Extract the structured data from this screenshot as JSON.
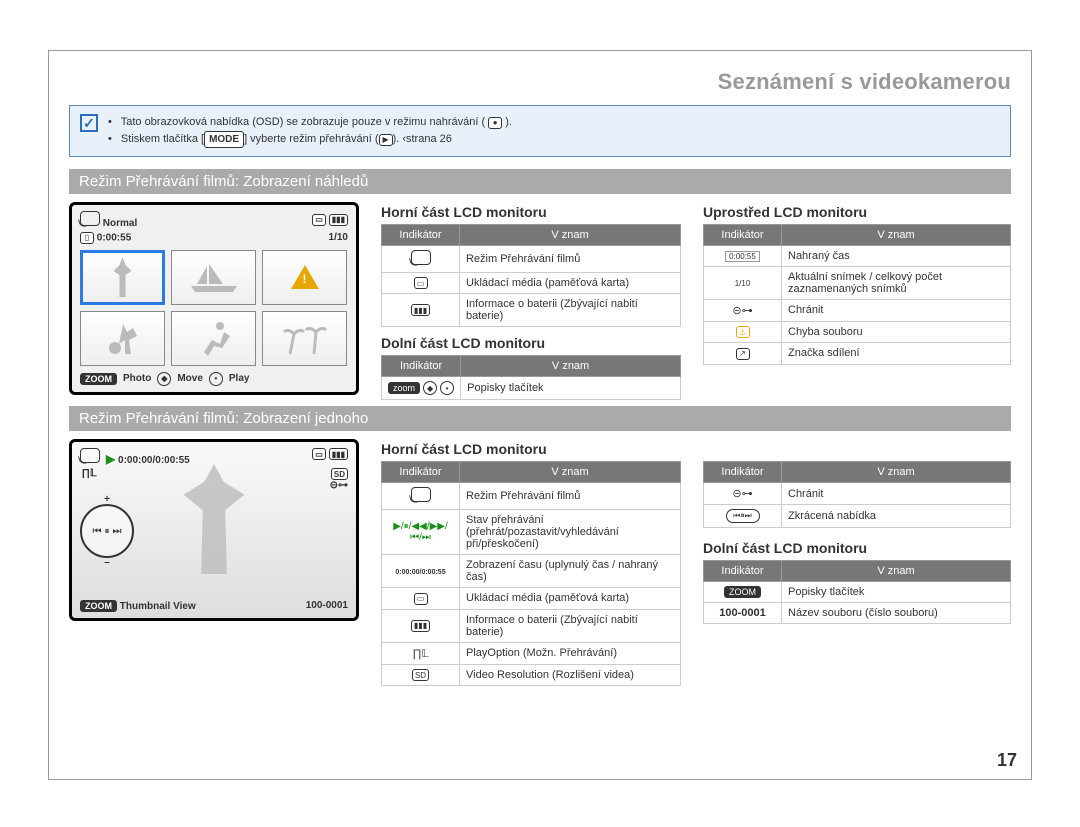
{
  "chapter_title": "Seznámení s videokamerou",
  "notebox": {
    "line1_prefix": "Tato obrazovková nabídka (OSD) se zobrazuje pouze v režimu nahrávání (",
    "line1_suffix": ").",
    "line2_prefix": "Stiskem tlačítka [",
    "line2_mode": "MODE",
    "line2_mid": "] vyberte režim přehrávání (",
    "line2_suffix": ").  ‹strana 26"
  },
  "section1": {
    "bar": "Režim Přehrávání filmů: Zobrazení náhledů",
    "osd": {
      "normal": "Normal",
      "time": "0:00:55",
      "counter": "1/10",
      "bottom_photo_key": "ZOOM",
      "bottom_photo": "Photo",
      "bottom_move": "Move",
      "bottom_play": "Play"
    },
    "top_col": {
      "heading": "Horní část LCD monitoru",
      "th_ind": "Indikátor",
      "th_mean": "V znam",
      "rows": [
        {
          "meaning": "Režim Přehrávání filmů"
        },
        {
          "meaning": "Ukládací média (paměťová karta)"
        },
        {
          "meaning": "Informace o baterii (Zbývající nabití baterie)"
        }
      ]
    },
    "bottom_col": {
      "heading": "Dolní část LCD monitoru",
      "th_ind": "Indikátor",
      "th_mean": "V znam",
      "rows": [
        {
          "meaning": "Popisky tlačítek"
        }
      ]
    },
    "right_col": {
      "heading": "Uprostřed LCD monitoru",
      "th_ind": "Indikátor",
      "th_mean": "V znam",
      "rows": [
        {
          "icon_text": "0:00:55",
          "meaning": "Nahraný čas"
        },
        {
          "icon_text": "1/10",
          "meaning": "Aktuální snímek / celkový počet zaznamenaných snímků"
        },
        {
          "icon_text": "⊝⊶",
          "meaning": "Chránit"
        },
        {
          "icon_text": "⚠",
          "meaning": "Chyba souboru"
        },
        {
          "icon_text": "",
          "meaning": "Značka sdílení"
        }
      ]
    }
  },
  "section2": {
    "bar": "Režim Přehrávání filmů: Zobrazení jednoho",
    "osd": {
      "time": "0:00:00/0:00:55",
      "sd": "SD",
      "thumb_key": "ZOOM",
      "thumb_label": "Thumbnail View",
      "thumb_file": "100-0001"
    },
    "left_col": {
      "heading": "Horní část LCD monitoru",
      "th_ind": "Indikátor",
      "th_mean": "V znam",
      "rows": [
        {
          "meaning": "Režim Přehrávání filmů"
        },
        {
          "meaning": "Stav přehrávání (přehrát/pozastavit/vyhledávání při/přeskočení)"
        },
        {
          "icon_text": "0:00:00/0:00:55",
          "meaning": "Zobrazení času (uplynulý čas / nahraný čas)"
        },
        {
          "meaning": "Ukládací média (paměťová karta)"
        },
        {
          "meaning": "Informace o baterii (Zbývající nabití baterie)"
        },
        {
          "icon_text": "∏𝕃",
          "meaning": "PlayOption (Možn. Přehrávání)"
        },
        {
          "icon_text": "SD",
          "meaning": "Video Resolution (Rozlišení videa)"
        }
      ]
    },
    "right_col_top": {
      "th_ind": "Indikátor",
      "th_mean": "V znam",
      "rows": [
        {
          "icon_text": "⊝⊶",
          "meaning": "Chránit"
        },
        {
          "meaning": "Zkrácená nabídka"
        }
      ]
    },
    "right_col_bottom": {
      "heading": "Dolní část LCD monitoru",
      "th_ind": "Indikátor",
      "th_mean": "V znam",
      "rows": [
        {
          "icon_text": "ZOOM",
          "meaning": "Popisky tlačítek"
        },
        {
          "icon_text": "100-0001",
          "meaning": "Název souboru (číslo souboru)"
        }
      ]
    }
  },
  "page_number": "17"
}
